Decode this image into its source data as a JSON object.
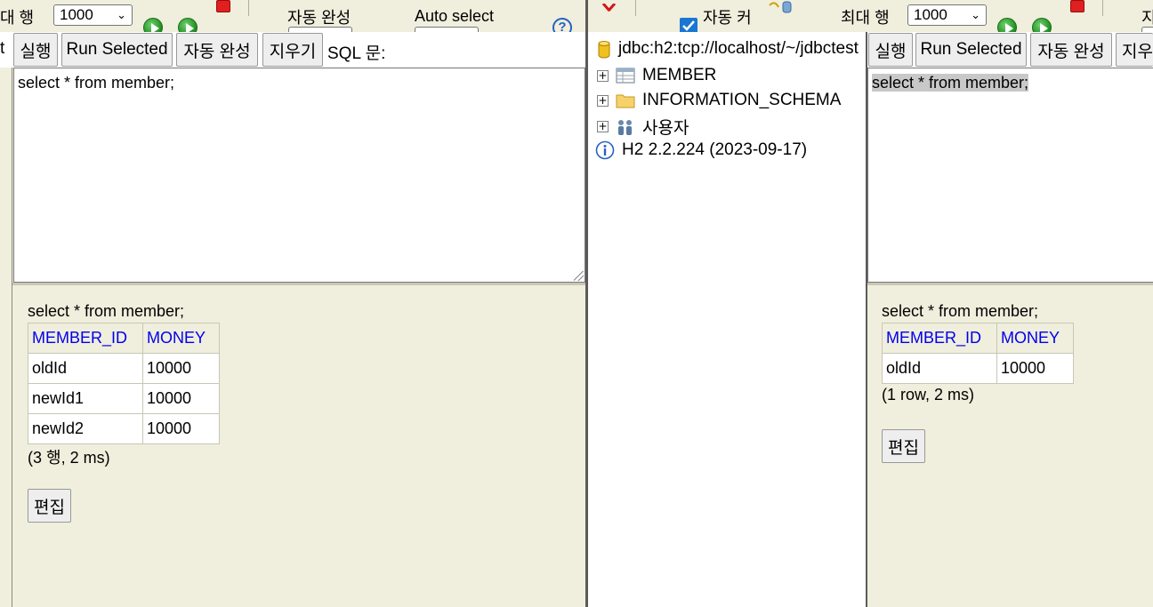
{
  "left_toolbar": {
    "max_rows_label": "대 행",
    "max_rows_value": "1000",
    "autocomplete_label": "자동 완성",
    "autoselect_label": "Auto select"
  },
  "left_buttons": {
    "cut_label": "t",
    "run": "실행",
    "run_selected": "Run Selected",
    "autocomplete": "자동 완성",
    "clear": "지우기",
    "sql_label": "SQL 문:"
  },
  "left_sql": "select * from member;",
  "left_result": {
    "query": "select * from member;",
    "columns": [
      "MEMBER_ID",
      "MONEY"
    ],
    "rows": [
      [
        "oldId",
        "10000"
      ],
      [
        "newId1",
        "10000"
      ],
      [
        "newId2",
        "10000"
      ]
    ],
    "summary": "(3 행, 2 ms)",
    "edit_label": "편집"
  },
  "right_toolbar": {
    "autocommit_label": "자동 커",
    "max_rows_label": "최대 행",
    "max_rows_value": "1000",
    "cut_label": "지"
  },
  "tree": {
    "connection": "jdbc:h2:tcp://localhost/~/jdbctest",
    "items": [
      {
        "label": "MEMBER",
        "icon": "table-icon"
      },
      {
        "label": "INFORMATION_SCHEMA",
        "icon": "folder-icon"
      },
      {
        "label": "사용자",
        "icon": "users-icon"
      }
    ],
    "version": "H2 2.2.224 (2023-09-17)"
  },
  "right_buttons": {
    "run": "실행",
    "run_selected": "Run Selected",
    "autocomplete": "자동 완성",
    "clear_cut": "지우"
  },
  "right_sql": "select * from member;",
  "right_result": {
    "query": "select * from member;",
    "columns": [
      "MEMBER_ID",
      "MONEY"
    ],
    "rows": [
      [
        "oldId",
        "10000"
      ]
    ],
    "summary": "(1 row, 2 ms)",
    "edit_label": "편집"
  },
  "colors": {
    "panel_bg": "#f0eedd",
    "header_link": "#0000ee",
    "play_green": "#1d8a1d",
    "stop_red": "#e02020"
  }
}
